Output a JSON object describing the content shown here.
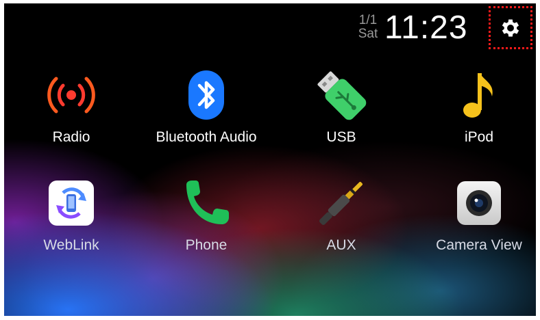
{
  "status": {
    "date_fraction": "1/1",
    "weekday": "Sat",
    "time": "11:23"
  },
  "settings": {
    "icon": "gear-icon"
  },
  "apps": [
    {
      "label": "Radio",
      "icon": "radio-broadcast-icon",
      "color": "#ff3b2f"
    },
    {
      "label": "Bluetooth Audio",
      "icon": "bluetooth-icon",
      "color": "#1a78ff"
    },
    {
      "label": "USB",
      "icon": "usb-drive-icon",
      "color": "#3fcf6a"
    },
    {
      "label": "iPod",
      "icon": "music-note-icon",
      "color": "#f6c21c"
    },
    {
      "label": "WebLink",
      "icon": "weblink-icon",
      "color": "#ffffff"
    },
    {
      "label": "Phone",
      "icon": "phone-icon",
      "color": "#1fbf58"
    },
    {
      "label": "AUX",
      "icon": "aux-jack-icon",
      "color": "#4a4a4a"
    },
    {
      "label": "Camera View",
      "icon": "camera-icon",
      "color": "#e6e6e6"
    }
  ]
}
